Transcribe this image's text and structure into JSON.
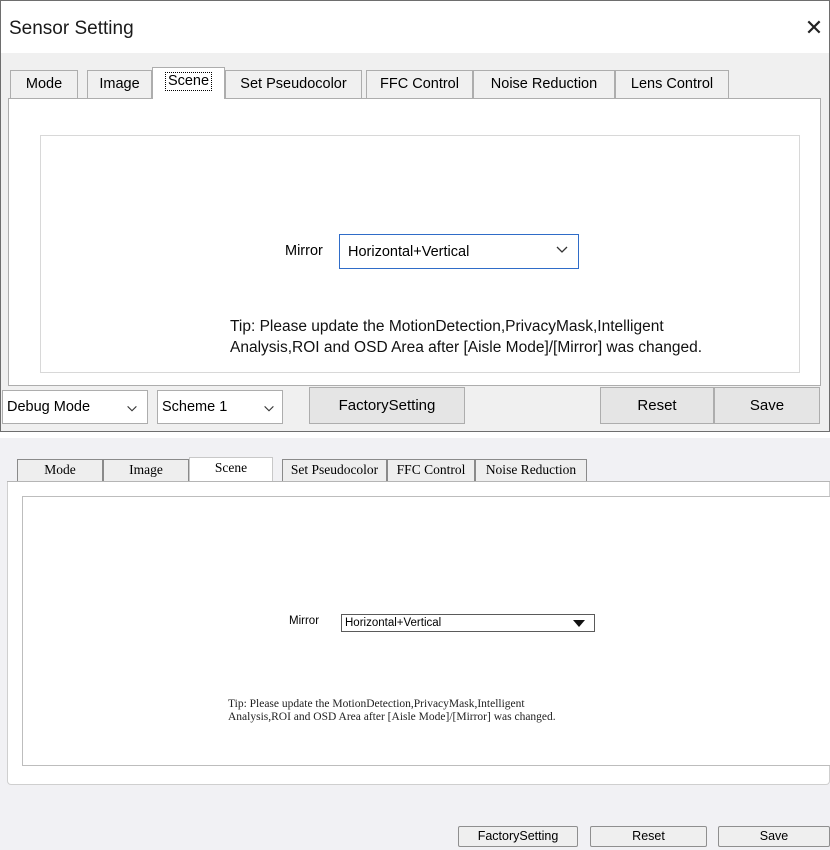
{
  "dialog": {
    "title": "Sensor Setting",
    "close_glyph": "✕",
    "tabs": [
      {
        "label": "Mode"
      },
      {
        "label": "Image"
      },
      {
        "label": "Scene"
      },
      {
        "label": "Set Pseudocolor"
      },
      {
        "label": "FFC Control"
      },
      {
        "label": "Noise Reduction"
      },
      {
        "label": "Lens Control"
      }
    ],
    "active_tab": "Scene",
    "mirror": {
      "label": "Mirror",
      "value": "Horizontal+Vertical"
    },
    "tip_line1": "Tip: Please update the MotionDetection,PrivacyMask,Intelligent",
    "tip_line2": "Analysis,ROI and OSD Area after [Aisle Mode]/[Mirror] was changed.",
    "debug_mode": "Debug Mode",
    "scheme": "Scheme 1",
    "factory_setting": "FactorySetting",
    "reset": "Reset",
    "save": "Save"
  },
  "panel": {
    "tabs": [
      {
        "label": "Mode"
      },
      {
        "label": "Image"
      },
      {
        "label": "Scene"
      },
      {
        "label": "Set Pseudocolor"
      },
      {
        "label": "FFC Control"
      },
      {
        "label": "Noise Reduction"
      }
    ],
    "active_tab": "Scene",
    "mirror": {
      "label": "Mirror",
      "value": "Horizontal+Vertical"
    },
    "tip_line1": "Tip: Please update the MotionDetection,PrivacyMask,Intelligent",
    "tip_line2": "Analysis,ROI and OSD Area after [Aisle Mode]/[Mirror] was changed.",
    "factory_setting": "FactorySetting",
    "reset": "Reset",
    "save": "Save"
  },
  "colors": {
    "focus_border": "#2f6cc8"
  }
}
